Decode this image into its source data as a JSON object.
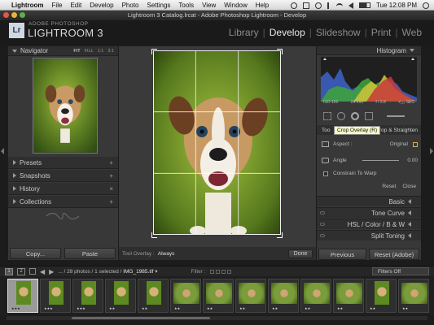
{
  "menubar": {
    "app": "Lightroom",
    "items": [
      "File",
      "Edit",
      "Develop",
      "Photo",
      "Settings",
      "Tools",
      "View",
      "Window",
      "Help"
    ],
    "clock": "Tue 12:08 PM"
  },
  "window": {
    "title": "Lightroom 3 Catalog.lrcat - Adobe Photoshop Lightroom - Develop"
  },
  "identity": {
    "logo": "Lr",
    "adobe_label": "ADOBE PHOTOSHOP",
    "product": "LIGHTROOM 3"
  },
  "modules": [
    "Library",
    "Develop",
    "Slideshow",
    "Print",
    "Web"
  ],
  "left_panel": {
    "navigator": {
      "title": "Navigator",
      "zoom": [
        "FIT",
        "FILL",
        "1:1",
        "3:1"
      ]
    },
    "sections": [
      "Presets",
      "Snapshots",
      "History",
      "Collections"
    ],
    "section_actions": [
      "+",
      "+",
      "×",
      "+"
    ],
    "copy_label": "Copy...",
    "paste_label": "Paste"
  },
  "center": {
    "tool_overlay_label": "Tool Overlay :",
    "tool_overlay_value": "Always",
    "done_label": "Done"
  },
  "right_panel": {
    "histogram_title": "Histogram",
    "histo_info": [
      "ISO 100",
      "24 mm",
      "f / 2.8",
      "¹⁄₁₂₅ SEC"
    ],
    "tooltip": "Crop Overlay (R)",
    "crop_header": "Crop & Straighten",
    "crop_header_prefix": "Too",
    "aspect_label": "Aspect :",
    "aspect_value": "Original",
    "angle_label": "Angle",
    "angle_value": "0.00",
    "constrain_label": "Constrain To Warp",
    "reset_label": "Reset",
    "close_label": "Close",
    "sections": [
      "Basic",
      "Tone Curve",
      "HSL / Color / B & W",
      "Split Toning"
    ],
    "previous_label": "Previous",
    "reset_adobe_label": "Reset (Adobe)"
  },
  "filmstrip_bar": {
    "pages": [
      "1",
      "2"
    ],
    "path_prefix": "... / 28 photos / 1 selected /",
    "filename": "IMG_1985.tif",
    "filter_label": "Filter :",
    "filters_value": "Filters Off"
  },
  "filmstrip": {
    "thumbs": [
      "portrait",
      "portrait",
      "portrait",
      "portrait",
      "portrait",
      "landscape",
      "landscape",
      "landscape",
      "landscape",
      "landscape",
      "landscape",
      "portrait",
      "landscape"
    ],
    "stars": [
      "★★★",
      "★★★",
      "★★★",
      "★★",
      "★★",
      "★★",
      "★★",
      "★★",
      "★★",
      "★★",
      "★★",
      "★★",
      "★★"
    ]
  },
  "colors": {
    "accent_logo": "#cfd7e2",
    "panel": "#383838",
    "background": "#1c1c1c"
  }
}
